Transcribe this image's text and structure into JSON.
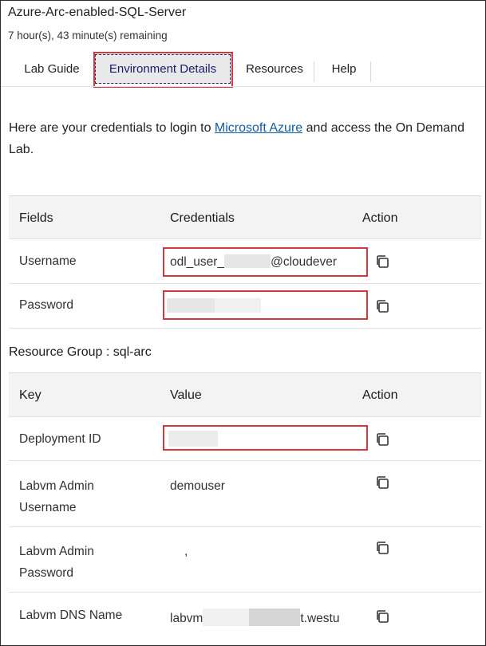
{
  "header": {
    "lab_title": "Azure-Arc-enabled-SQL-Server",
    "time_remaining": "7 hour(s), 43 minute(s) remaining"
  },
  "tabs": [
    {
      "label": "Lab Guide",
      "active": false
    },
    {
      "label": "Environment Details",
      "active": true
    },
    {
      "label": "Resources",
      "active": false
    },
    {
      "label": "Help",
      "active": false
    }
  ],
  "intro": {
    "before": "Here are your credentials to login to ",
    "link": "Microsoft Azure",
    "after": " and access the On Demand Lab."
  },
  "credentials_table": {
    "headers": {
      "fields": "Fields",
      "credentials": "Credentials",
      "action": "Action"
    },
    "rows": [
      {
        "field": "Username",
        "value_prefix": "odl_user_",
        "value_suffix": "@cloudever"
      },
      {
        "field": "Password",
        "value_prefix": "",
        "value_suffix": ""
      }
    ]
  },
  "resource_group": {
    "label": "Resource Group : sql-arc"
  },
  "resource_table": {
    "headers": {
      "key": "Key",
      "value": "Value",
      "action": "Action"
    },
    "rows": [
      {
        "key": "Deployment ID",
        "value": ""
      },
      {
        "key": "Labvm Admin Username",
        "value": "demouser"
      },
      {
        "key": "Labvm Admin Password",
        "value": ","
      },
      {
        "key": "Labvm DNS Name",
        "value_prefix": "labvm",
        "value_suffix": "t.westu"
      }
    ]
  },
  "colors": {
    "highlight": "#d9363e",
    "link": "#0f5ca8",
    "active_tab_text": "#1a1a6e"
  },
  "icons": {
    "copy": "copy-icon"
  }
}
